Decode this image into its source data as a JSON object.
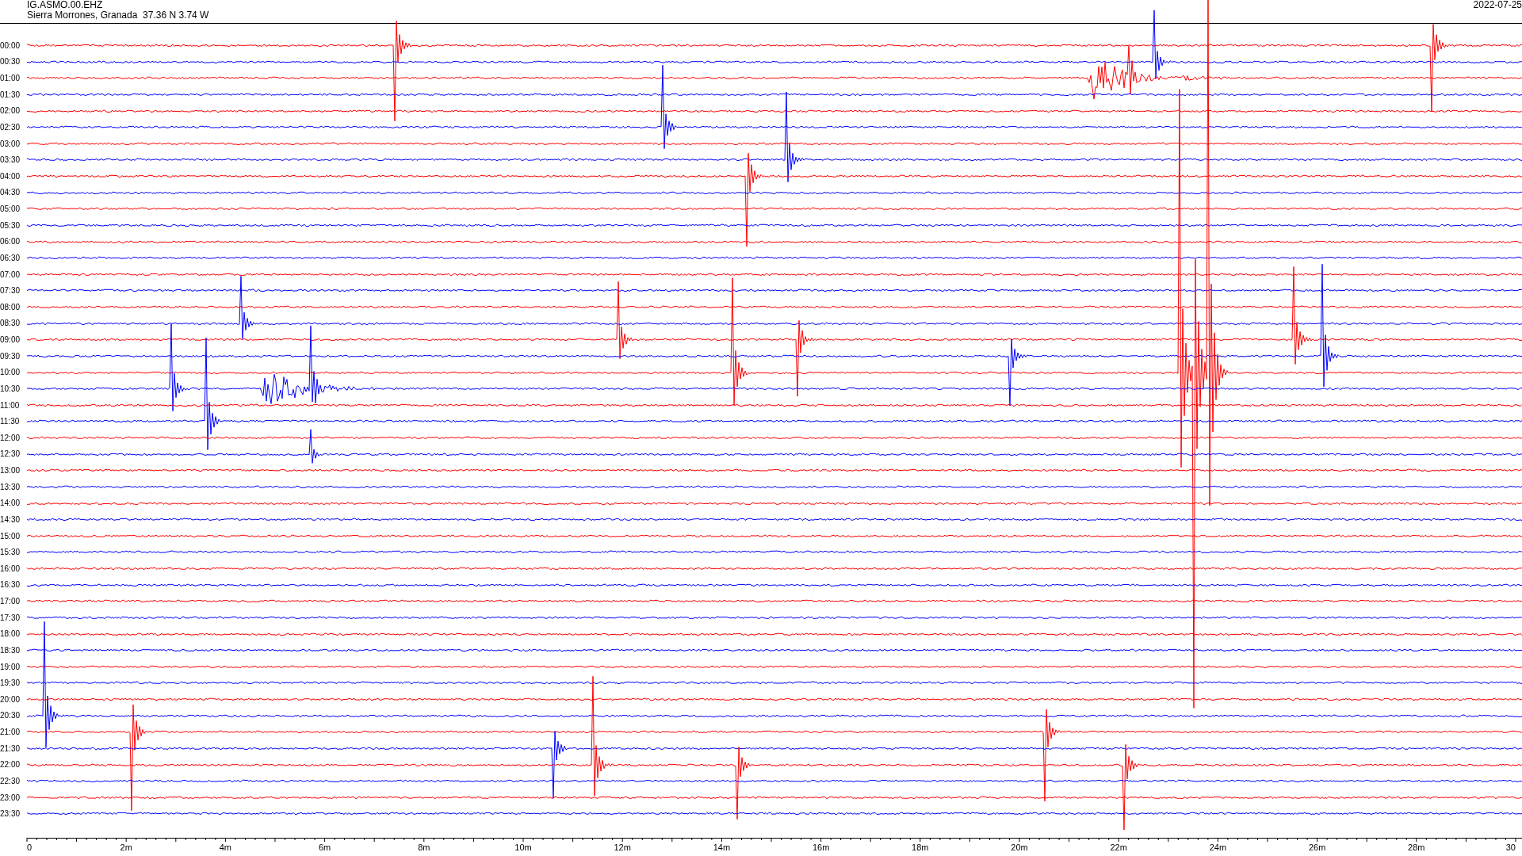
{
  "header": {
    "station": "IG.ASMO.00.EHZ",
    "location": "Sierra Morrones, Granada  37.36 N 3.74 W",
    "date": "2022-07-25"
  },
  "traces": [
    {
      "time": "00:00",
      "color": "#ff0000"
    },
    {
      "time": "00:30",
      "color": "#0000ff"
    },
    {
      "time": "01:00",
      "color": "#ff0000"
    },
    {
      "time": "01:30",
      "color": "#0000ff"
    },
    {
      "time": "02:00",
      "color": "#ff0000"
    },
    {
      "time": "02:30",
      "color": "#0000ff"
    },
    {
      "time": "03:00",
      "color": "#ff0000"
    },
    {
      "time": "03:30",
      "color": "#0000ff"
    },
    {
      "time": "04:00",
      "color": "#ff0000"
    },
    {
      "time": "04:30",
      "color": "#0000ff"
    },
    {
      "time": "05:00",
      "color": "#ff0000"
    },
    {
      "time": "05:30",
      "color": "#0000ff"
    },
    {
      "time": "06:00",
      "color": "#ff0000"
    },
    {
      "time": "06:30",
      "color": "#0000ff"
    },
    {
      "time": "07:00",
      "color": "#ff0000"
    },
    {
      "time": "07:30",
      "color": "#0000ff"
    },
    {
      "time": "08:00",
      "color": "#ff0000"
    },
    {
      "time": "08:30",
      "color": "#0000ff"
    },
    {
      "time": "09:00",
      "color": "#ff0000"
    },
    {
      "time": "09:30",
      "color": "#0000ff"
    },
    {
      "time": "10:00",
      "color": "#ff0000"
    },
    {
      "time": "10:30",
      "color": "#0000ff"
    },
    {
      "time": "11:00",
      "color": "#ff0000"
    },
    {
      "time": "11:30",
      "color": "#0000ff"
    },
    {
      "time": "12:00",
      "color": "#ff0000"
    },
    {
      "time": "12:30",
      "color": "#0000ff"
    },
    {
      "time": "13:00",
      "color": "#ff0000"
    },
    {
      "time": "13:30",
      "color": "#0000ff"
    },
    {
      "time": "14:00",
      "color": "#ff0000"
    },
    {
      "time": "14:30",
      "color": "#0000ff"
    },
    {
      "time": "15:00",
      "color": "#ff0000"
    },
    {
      "time": "15:30",
      "color": "#0000ff"
    },
    {
      "time": "16:00",
      "color": "#ff0000"
    },
    {
      "time": "16:30",
      "color": "#0000ff"
    },
    {
      "time": "17:00",
      "color": "#ff0000"
    },
    {
      "time": "17:30",
      "color": "#0000ff"
    },
    {
      "time": "18:00",
      "color": "#ff0000"
    },
    {
      "time": "18:30",
      "color": "#0000ff"
    },
    {
      "time": "19:00",
      "color": "#ff0000"
    },
    {
      "time": "19:30",
      "color": "#0000ff"
    },
    {
      "time": "20:00",
      "color": "#ff0000"
    },
    {
      "time": "20:30",
      "color": "#0000ff"
    },
    {
      "time": "21:00",
      "color": "#ff0000"
    },
    {
      "time": "21:30",
      "color": "#0000ff"
    },
    {
      "time": "22:00",
      "color": "#ff0000"
    },
    {
      "time": "22:30",
      "color": "#0000ff"
    },
    {
      "time": "23:00",
      "color": "#ff0000"
    },
    {
      "time": "23:30",
      "color": "#0000ff"
    }
  ],
  "x_axis": {
    "ticks": [
      "0",
      "2m",
      "4m",
      "6m",
      "8m",
      "10m",
      "12m",
      "14m",
      "16m",
      "18m",
      "20m",
      "22m",
      "24m",
      "26m",
      "28m",
      "30"
    ]
  }
}
